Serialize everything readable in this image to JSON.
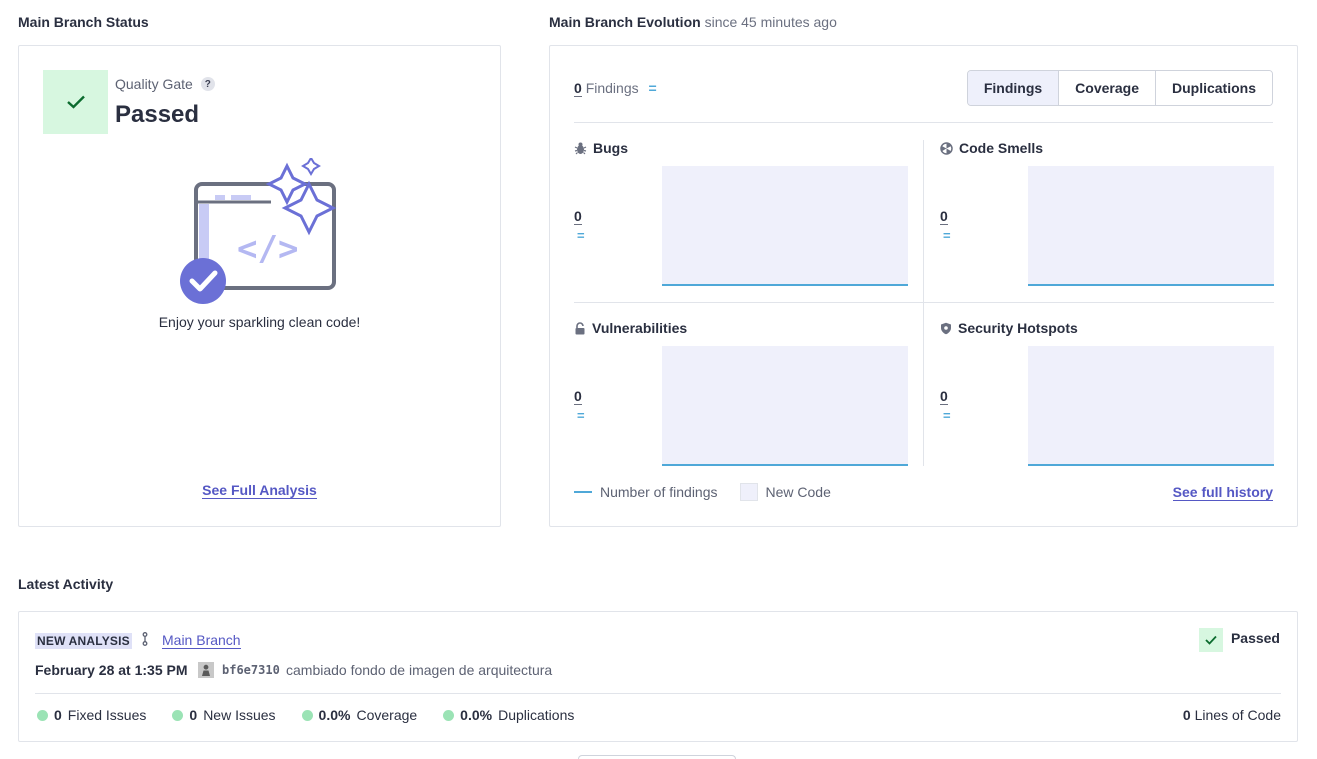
{
  "status": {
    "section_title": "Main Branch Status",
    "quality_gate_label": "Quality Gate",
    "help_glyph": "?",
    "quality_gate_status": "Passed",
    "enjoy_text": "Enjoy your sparkling clean code!",
    "see_full_analysis": "See Full Analysis"
  },
  "evolution": {
    "section_title": "Main Branch Evolution",
    "since": "since 45 minutes ago",
    "findings_count": "0",
    "findings_label": "Findings",
    "eq_glyph": "=",
    "tabs": [
      {
        "label": "Findings",
        "active": true
      },
      {
        "label": "Coverage",
        "active": false
      },
      {
        "label": "Duplications",
        "active": false
      }
    ],
    "quadrants": [
      {
        "title": "Bugs",
        "icon": "bug-icon",
        "value": "0",
        "eq": "="
      },
      {
        "title": "Code Smells",
        "icon": "code-smell-icon",
        "value": "0",
        "eq": "="
      },
      {
        "title": "Vulnerabilities",
        "icon": "lock-icon",
        "value": "0",
        "eq": "="
      },
      {
        "title": "Security Hotspots",
        "icon": "shield-icon",
        "value": "0",
        "eq": "="
      }
    ],
    "legend_line": "Number of findings",
    "legend_box": "New Code",
    "see_full_history": "See full history"
  },
  "activity": {
    "section_title": "Latest Activity",
    "badge": "NEW ANALYSIS",
    "branch_link": "Main Branch",
    "status": "Passed",
    "date": "February 28 at 1:35 PM",
    "commit_hash": "bf6e7310",
    "commit_message": "cambiado fondo de imagen de arquitectura",
    "metrics": [
      {
        "value": "0",
        "label": "Fixed Issues"
      },
      {
        "value": "0",
        "label": "New Issues"
      },
      {
        "value": "0.0%",
        "label": "Coverage"
      },
      {
        "value": "0.0%",
        "label": "Duplications"
      }
    ],
    "lines_of_code_value": "0",
    "lines_of_code_label": "Lines of Code"
  },
  "colors": {
    "accent": "#5558c4",
    "pass_bg": "#d7f7e0",
    "pass_check": "#0b6b2e",
    "chart_line": "#4fa8d8",
    "chart_bg": "#eff0fb",
    "metric_dot": "#9be3b5"
  }
}
